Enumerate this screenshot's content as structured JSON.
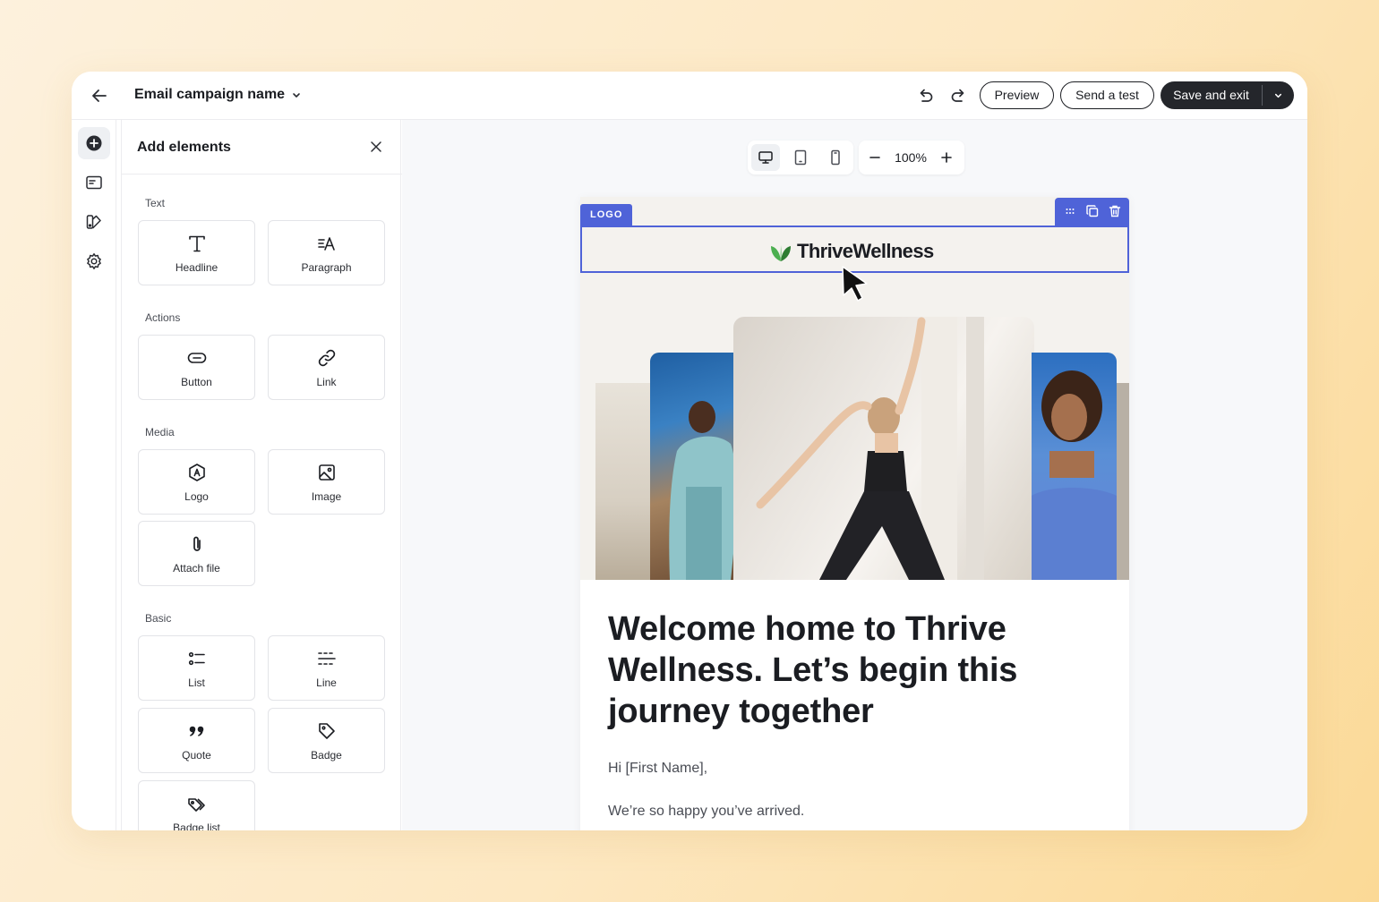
{
  "header": {
    "campaign_name": "Email campaign name",
    "preview_label": "Preview",
    "send_test_label": "Send a test",
    "save_label": "Save and exit"
  },
  "rail": {
    "items": [
      "add-elements",
      "content",
      "brand",
      "settings"
    ]
  },
  "panel": {
    "title": "Add elements",
    "sections": [
      {
        "label": "Text",
        "items": [
          {
            "label": "Headline",
            "icon": "headline-icon"
          },
          {
            "label": "Paragraph",
            "icon": "paragraph-icon"
          }
        ]
      },
      {
        "label": "Actions",
        "items": [
          {
            "label": "Button",
            "icon": "button-icon"
          },
          {
            "label": "Link",
            "icon": "link-icon"
          }
        ]
      },
      {
        "label": "Media",
        "items": [
          {
            "label": "Logo",
            "icon": "logo-icon"
          },
          {
            "label": "Image",
            "icon": "image-icon"
          },
          {
            "label": "Attach file",
            "icon": "paperclip-icon"
          }
        ]
      },
      {
        "label": "Basic",
        "items": [
          {
            "label": "List",
            "icon": "list-icon"
          },
          {
            "label": "Line",
            "icon": "line-icon"
          },
          {
            "label": "Quote",
            "icon": "quote-icon"
          },
          {
            "label": "Badge",
            "icon": "tag-icon"
          },
          {
            "label": "Badge list",
            "icon": "tags-icon"
          }
        ]
      }
    ]
  },
  "canvas": {
    "zoom": "100%",
    "active_device": "desktop"
  },
  "email": {
    "logo_tag": "LOGO",
    "brand_name": "ThriveWellness",
    "heading": "Welcome home to Thrive Wellness. Let’s begin this journey together",
    "greeting": "Hi [First Name],",
    "body": "We’re so happy you’ve arrived."
  },
  "colors": {
    "accent": "#4f63d8",
    "primary_button": "#24262b",
    "brand_leaf": "#4caf50"
  }
}
